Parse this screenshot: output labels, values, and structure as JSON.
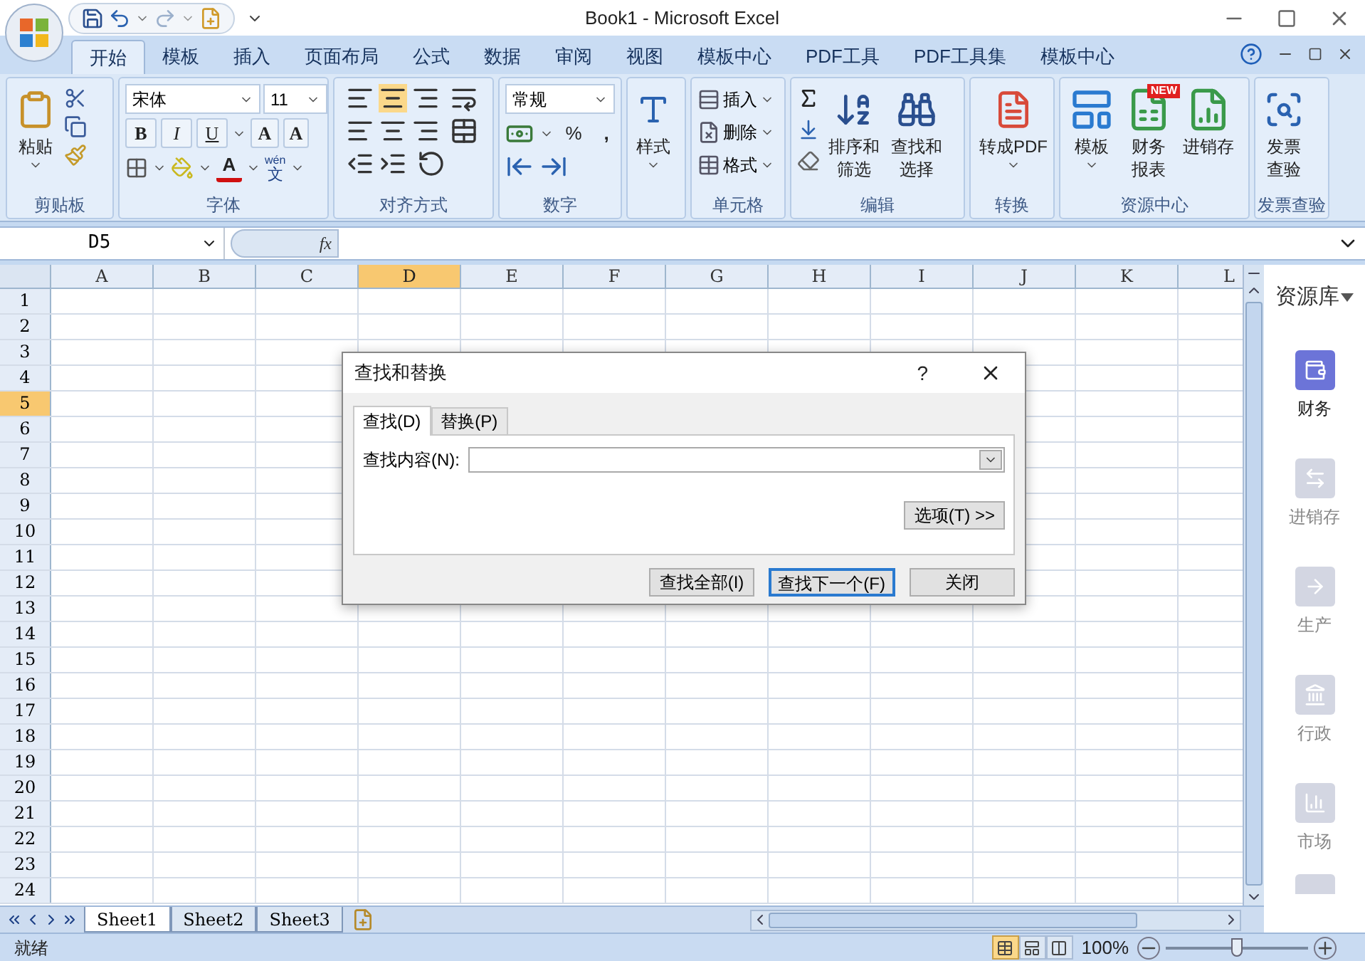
{
  "title": "Book1 - Microsoft Excel",
  "tabs": [
    {
      "label": "开始",
      "selected": true
    },
    {
      "label": "模板",
      "selected": false
    },
    {
      "label": "插入",
      "selected": false
    },
    {
      "label": "页面布局",
      "selected": false
    },
    {
      "label": "公式",
      "selected": false
    },
    {
      "label": "数据",
      "selected": false
    },
    {
      "label": "审阅",
      "selected": false
    },
    {
      "label": "视图",
      "selected": false
    },
    {
      "label": "模板中心",
      "selected": false
    },
    {
      "label": "PDF工具",
      "selected": false
    },
    {
      "label": "PDF工具集",
      "selected": false
    },
    {
      "label": "模板中心",
      "selected": false
    }
  ],
  "ribbon": {
    "clipboard": {
      "label": "剪贴板",
      "paste": "粘贴"
    },
    "font": {
      "label": "字体",
      "font_name": "宋体",
      "font_size": "11",
      "styles": [
        "B",
        "I",
        "U"
      ],
      "grow": "A",
      "shrink": "A",
      "font_color": "A",
      "phonetic_top": "wén",
      "phonetic_bottom": "文"
    },
    "alignment": {
      "label": "对齐方式"
    },
    "number": {
      "label": "数字",
      "format": "常规",
      "percent": "%",
      "comma": ","
    },
    "styles": {
      "button": "样式"
    },
    "cells": {
      "label": "单元格",
      "items": [
        "插入",
        "删除",
        "格式"
      ]
    },
    "editing": {
      "label": "编辑",
      "buttons": [
        {
          "kind": "sort",
          "lines": [
            "排序和",
            "筛选"
          ]
        },
        {
          "kind": "find",
          "lines": [
            "查找和",
            "选择"
          ]
        }
      ]
    },
    "convert": {
      "label": "转换",
      "button": "转成PDF"
    },
    "resources": {
      "label": "资源中心",
      "buttons": [
        {
          "kind": "template",
          "lines": [
            "模板"
          ]
        },
        {
          "kind": "report",
          "lines": [
            "财务",
            "报表"
          ],
          "badge": "NEW"
        },
        {
          "kind": "inventory",
          "lines": [
            "进销存"
          ]
        }
      ]
    },
    "invoice": {
      "label": "发票查验",
      "lines": [
        "发票",
        "查验"
      ]
    }
  },
  "formula_bar": {
    "name_box": "D5",
    "function_label": "fx"
  },
  "sheet": {
    "columns": [
      {
        "label": "A",
        "selected": false
      },
      {
        "label": "B",
        "selected": false
      },
      {
        "label": "C",
        "selected": false
      },
      {
        "label": "D",
        "selected": true
      },
      {
        "label": "E",
        "selected": false
      },
      {
        "label": "F",
        "selected": false
      },
      {
        "label": "G",
        "selected": false
      },
      {
        "label": "H",
        "selected": false
      },
      {
        "label": "I",
        "selected": false
      },
      {
        "label": "J",
        "selected": false
      },
      {
        "label": "K",
        "selected": false
      },
      {
        "label": "L",
        "selected": false
      }
    ],
    "rows": [
      {
        "label": "1",
        "selected": false
      },
      {
        "label": "2",
        "selected": false
      },
      {
        "label": "3",
        "selected": false
      },
      {
        "label": "4",
        "selected": false
      },
      {
        "label": "5",
        "selected": true
      },
      {
        "label": "6",
        "selected": false
      },
      {
        "label": "7",
        "selected": false
      },
      {
        "label": "8",
        "selected": false
      },
      {
        "label": "9",
        "selected": false
      },
      {
        "label": "10",
        "selected": false
      },
      {
        "label": "11",
        "selected": false
      },
      {
        "label": "12",
        "selected": false
      },
      {
        "label": "13",
        "selected": false
      },
      {
        "label": "14",
        "selected": false
      },
      {
        "label": "15",
        "selected": false
      },
      {
        "label": "16",
        "selected": false
      },
      {
        "label": "17",
        "selected": false
      },
      {
        "label": "18",
        "selected": false
      },
      {
        "label": "19",
        "selected": false
      },
      {
        "label": "20",
        "selected": false
      },
      {
        "label": "21",
        "selected": false
      },
      {
        "label": "22",
        "selected": false
      },
      {
        "label": "23",
        "selected": false
      },
      {
        "label": "24",
        "selected": false
      }
    ]
  },
  "sheet_tabs": [
    {
      "label": "Sheet1",
      "selected": true
    },
    {
      "label": "Sheet2",
      "selected": false
    },
    {
      "label": "Sheet3",
      "selected": false
    }
  ],
  "status_bar": {
    "text": "就绪",
    "views": [
      {
        "kind": "normal",
        "selected": true
      },
      {
        "kind": "layout",
        "selected": false
      },
      {
        "kind": "pagebreak",
        "selected": false
      }
    ],
    "zoom": "100%",
    "zoom_slider": {
      "level": 0.5
    }
  },
  "sidebar": {
    "title": "资源库",
    "items": [
      {
        "label": "财务",
        "kind": "finance",
        "selected": true
      },
      {
        "label": "进销存",
        "kind": "inventory",
        "selected": false
      },
      {
        "label": "生产",
        "kind": "production",
        "selected": false
      },
      {
        "label": "行政",
        "kind": "admin",
        "selected": false
      },
      {
        "label": "市场",
        "kind": "market",
        "selected": false
      }
    ]
  },
  "dialog": {
    "title": "查找和替换",
    "help": "?",
    "tabs": [
      {
        "label": "查找(D)",
        "selected": true
      },
      {
        "label": "替换(P)",
        "selected": false
      }
    ],
    "field_label": "查找内容(N):",
    "options_button": "选项(T) >>",
    "buttons": [
      {
        "label": "查找全部(I)",
        "default": false
      },
      {
        "label": "查找下一个(F)",
        "default": true
      },
      {
        "label": "关闭",
        "default": false
      }
    ]
  }
}
